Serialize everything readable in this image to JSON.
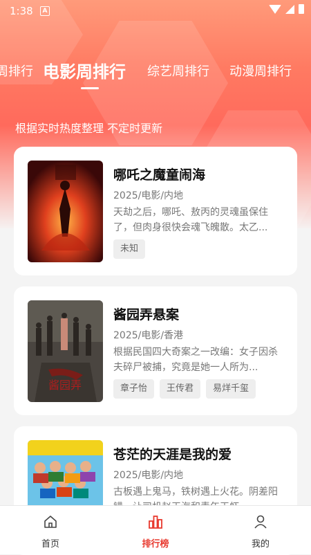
{
  "status": {
    "time": "1:38",
    "a_label": "A"
  },
  "tabs": [
    {
      "label": "周排行"
    },
    {
      "label": "电影周排行"
    },
    {
      "label": "综艺周排行"
    },
    {
      "label": "动漫周排行"
    }
  ],
  "subtitle": "根据实时热度整理 不定时更新",
  "cards": [
    {
      "title": "哪吒之魔童闹海",
      "meta": "2025/电影/内地",
      "desc": "天劫之后，哪吒、敖丙的灵魂虽保住了，但肉身很快会魂飞魄散。太乙...",
      "tags": [
        "未知"
      ]
    },
    {
      "title": "酱园弄悬案",
      "meta": "2025/电影/香港",
      "desc": "根据民国四大奇案之一改编：女子因杀夫碎尸被捕，究竟是她一人所为...",
      "tags": [
        "章子怡",
        "王传君",
        "易烊千玺"
      ]
    },
    {
      "title": "苍茫的天涯是我的爱",
      "meta": "2025/电影/内地",
      "desc": "古板遇上鬼马，铁树遇上火花。阴差阳错，让司机赵王海和青年王虾…",
      "tags": []
    }
  ],
  "nav": [
    {
      "label": "首页",
      "icon": "home-icon"
    },
    {
      "label": "排行榜",
      "icon": "chart-icon"
    },
    {
      "label": "我的",
      "icon": "user-icon"
    }
  ],
  "colors": {
    "accent": "#e8392e",
    "header_top": "#ff9a7a",
    "header_mid": "#ff6a5c"
  }
}
